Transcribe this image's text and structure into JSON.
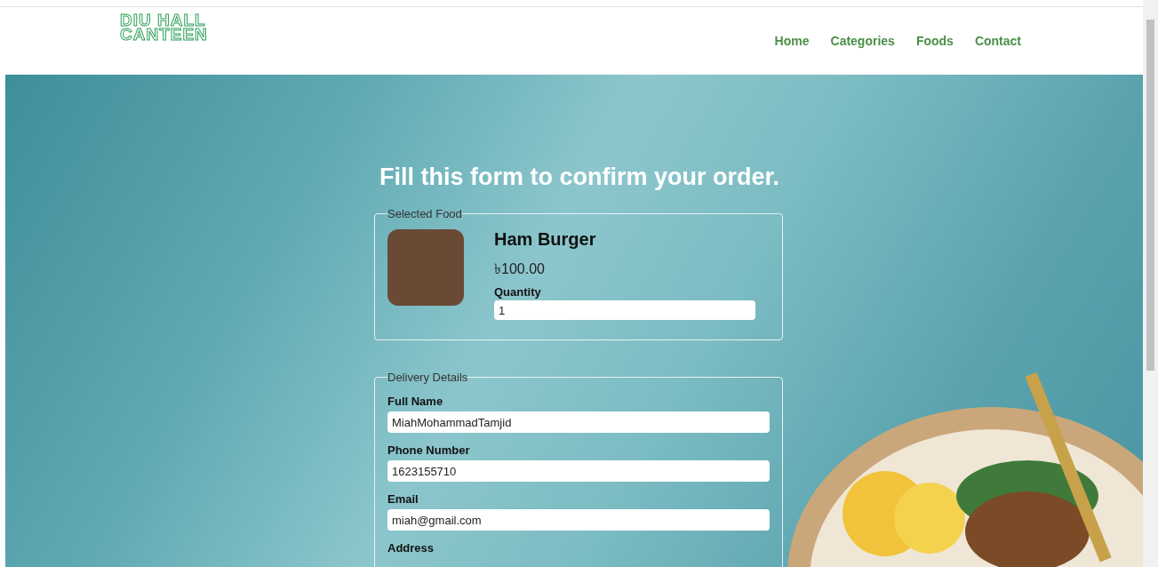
{
  "logo": {
    "lines": [
      "DIU HALL",
      "CANTEEN"
    ]
  },
  "nav": [
    {
      "label": "Home"
    },
    {
      "label": "Categories"
    },
    {
      "label": "Foods"
    },
    {
      "label": "Contact"
    }
  ],
  "heading": "Fill this form to confirm your order.",
  "selected_food": {
    "legend": "Selected Food",
    "name": "Ham Burger",
    "price": "৳100.00",
    "quantity_label": "Quantity",
    "quantity_value": "1"
  },
  "delivery": {
    "legend": "Delivery Details",
    "fields": [
      {
        "label": "Full Name",
        "value": "MiahMohammadTamjid"
      },
      {
        "label": "Phone Number",
        "value": "1623155710"
      },
      {
        "label": "Email",
        "value": "miah@gmail.com"
      }
    ],
    "next_label": "Address"
  }
}
